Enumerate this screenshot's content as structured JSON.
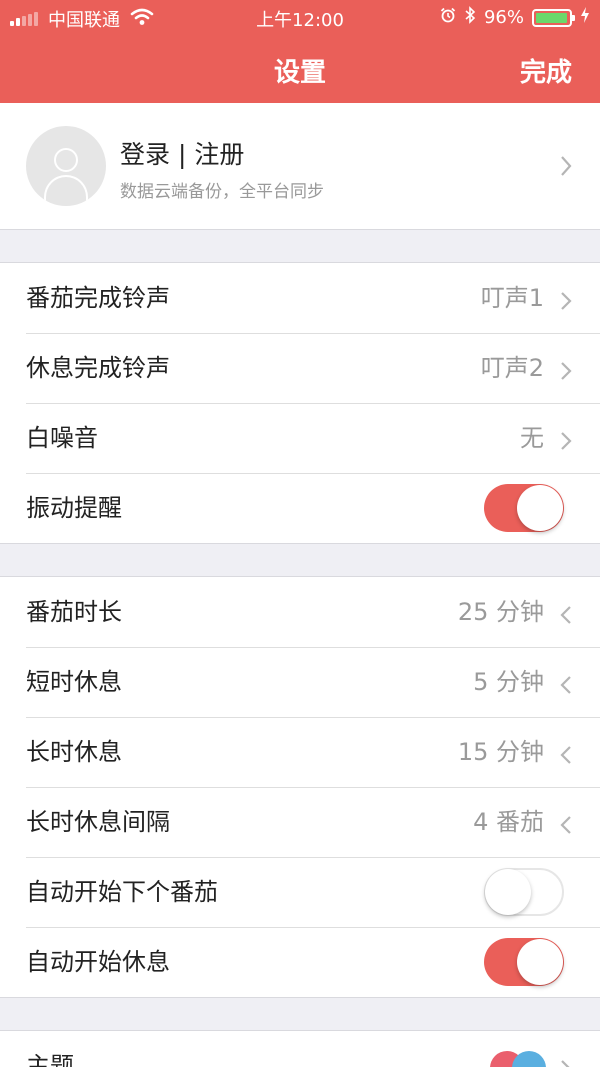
{
  "status_bar": {
    "carrier": "中国联通",
    "time": "上午12:00",
    "battery_percent": "96%",
    "battery_level": 0.96,
    "icons": [
      "signal-icon",
      "wifi-icon",
      "alarm-icon",
      "bluetooth-icon",
      "battery-icon",
      "charging-icon"
    ]
  },
  "nav": {
    "title": "设置",
    "done_label": "完成"
  },
  "profile": {
    "title": "登录 | 注册",
    "subtitle": "数据云端备份，全平台同步"
  },
  "sound_settings": [
    {
      "label": "番茄完成铃声",
      "value": "叮声1",
      "type": "select"
    },
    {
      "label": "休息完成铃声",
      "value": "叮声2",
      "type": "select"
    },
    {
      "label": "白噪音",
      "value": "无",
      "type": "select"
    },
    {
      "label": "振动提醒",
      "type": "toggle",
      "on": true
    }
  ],
  "timer_settings": [
    {
      "label": "番茄时长",
      "value": "25 分钟",
      "type": "stepper"
    },
    {
      "label": "短时休息",
      "value": "5 分钟",
      "type": "stepper"
    },
    {
      "label": "长时休息",
      "value": "15 分钟",
      "type": "stepper"
    },
    {
      "label": "长时休息间隔",
      "value": "4 番茄",
      "type": "stepper"
    },
    {
      "label": "自动开始下个番茄",
      "type": "toggle",
      "on": false
    },
    {
      "label": "自动开始休息",
      "type": "toggle",
      "on": true
    }
  ],
  "theme": {
    "label": "主题",
    "swatch_colors": [
      "#ea5f6d",
      "#5aafe0"
    ]
  },
  "colors": {
    "accent": "#ea5f59",
    "background": "#efeff4",
    "value_text": "#9a9a9a"
  }
}
